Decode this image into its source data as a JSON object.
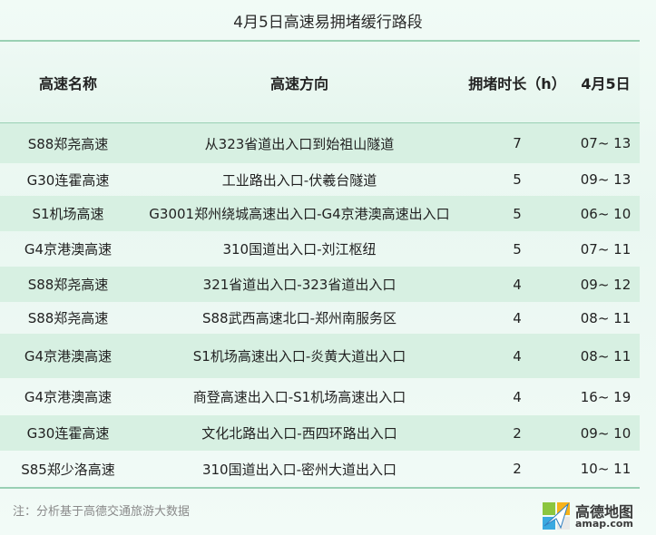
{
  "title": "4月5日高速易拥堵缓行路段",
  "table": {
    "headers": [
      "高速名称",
      "高速方向",
      "拥堵时长（h）",
      "4月5日"
    ],
    "rows": [
      {
        "name": "S88郑尧高速",
        "direction": "从323省道出入口到始祖山隧道",
        "hours": "7",
        "time": "07~ 13"
      },
      {
        "name": "G30连霍高速",
        "direction": "工业路出入口-伏羲台隧道",
        "hours": "5",
        "time": "09~ 13"
      },
      {
        "name": "S1机场高速",
        "direction": "G3001郑州绕城高速出入口-G4京港澳高速出入口",
        "hours": "5",
        "time": "06~ 10"
      },
      {
        "name": "G4京港澳高速",
        "direction": "310国道出入口-刘江枢纽",
        "hours": "5",
        "time": "07~ 11"
      },
      {
        "name": "S88郑尧高速",
        "direction": "321省道出入口-323省道出入口",
        "hours": "4",
        "time": "09~ 12"
      },
      {
        "name": "S88郑尧高速",
        "direction": "S88武西高速北口-郑州南服务区",
        "hours": "4",
        "time": "08~ 11"
      },
      {
        "name": "G4京港澳高速",
        "direction": "S1机场高速出入口-炎黄大道出入口",
        "hours": "4",
        "time": "08~ 11"
      },
      {
        "name": "G4京港澳高速",
        "direction": "商登高速出入口-S1机场高速出入口",
        "hours": "4",
        "time": "16~ 19"
      },
      {
        "name": "G30连霍高速",
        "direction": "文化北路出入口-西四环路出入口",
        "hours": "2",
        "time": "09~ 10"
      },
      {
        "name": "S85郑少洛高速",
        "direction": "310国道出入口-密州大道出入口",
        "hours": "2",
        "time": "10~ 11"
      }
    ]
  },
  "footer": {
    "note": "注：分析基于高德交通旅游大数据",
    "logo_name": "高德地图",
    "logo_url": "amap.com"
  },
  "colors": {
    "row_alt": "#d7f0e2",
    "rule": "#9ad0b4",
    "background": "#eef9f4"
  }
}
